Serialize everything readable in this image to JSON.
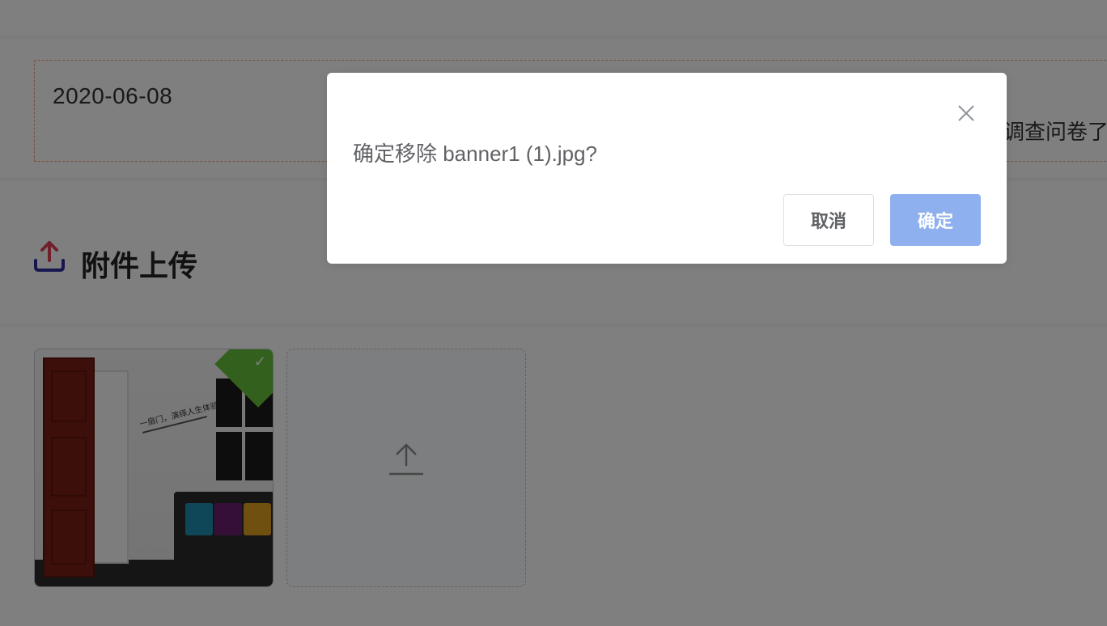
{
  "date_field": {
    "value": "2020-06-08"
  },
  "side_text": "调查问卷了",
  "upload_section": {
    "title": "附件上传",
    "icon": "upload-icon"
  },
  "files": [
    {
      "name": "banner1 (1).jpg",
      "status": "success",
      "quote_text": "一扇门，演绎人生体验"
    }
  ],
  "uploader": {
    "icon": "upload-arrow-icon"
  },
  "dialog": {
    "message": "确定移除 banner1 (1).jpg?",
    "cancel_label": "取消",
    "confirm_label": "确定",
    "close_icon": "close-icon"
  },
  "colors": {
    "confirm_button": "#8fb0ee",
    "success_corner": "#67c23a",
    "date_border": "#f0a070",
    "upload_icon_top": "#e0405a",
    "upload_icon_bottom": "#2f2fa0"
  }
}
